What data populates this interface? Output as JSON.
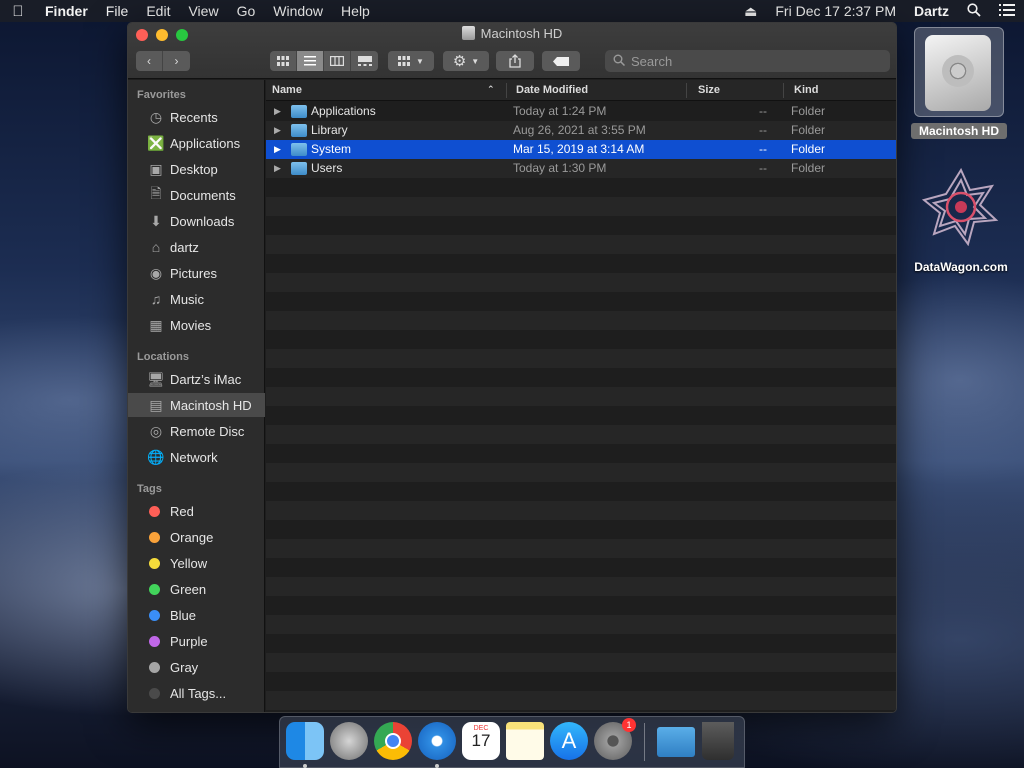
{
  "menubar": {
    "apple_icon": "apple-icon",
    "app_name": "Finder",
    "menus": [
      "File",
      "Edit",
      "View",
      "Go",
      "Window",
      "Help"
    ],
    "datetime": "Fri Dec 17  2:37 PM",
    "user": "Dartz"
  },
  "window": {
    "title": "Macintosh HD",
    "search_placeholder": "Search"
  },
  "sidebar": {
    "favorites_heading": "Favorites",
    "favorites": [
      {
        "label": "Recents",
        "icon": "clock-icon"
      },
      {
        "label": "Applications",
        "icon": "applications-icon"
      },
      {
        "label": "Desktop",
        "icon": "desktop-icon"
      },
      {
        "label": "Documents",
        "icon": "documents-icon"
      },
      {
        "label": "Downloads",
        "icon": "downloads-icon"
      },
      {
        "label": "dartz",
        "icon": "home-icon"
      },
      {
        "label": "Pictures",
        "icon": "camera-icon"
      },
      {
        "label": "Music",
        "icon": "music-icon"
      },
      {
        "label": "Movies",
        "icon": "film-icon"
      }
    ],
    "locations_heading": "Locations",
    "locations": [
      {
        "label": "Dartz’s iMac",
        "icon": "imac-icon"
      },
      {
        "label": "Macintosh HD",
        "icon": "hard-drive-icon",
        "selected": true
      },
      {
        "label": "Remote Disc",
        "icon": "disc-icon"
      },
      {
        "label": "Network",
        "icon": "network-icon"
      }
    ],
    "tags_heading": "Tags",
    "tags": [
      {
        "label": "Red",
        "color": "#fe5f57"
      },
      {
        "label": "Orange",
        "color": "#f9a23a"
      },
      {
        "label": "Yellow",
        "color": "#f5dc3b"
      },
      {
        "label": "Green",
        "color": "#42d45b"
      },
      {
        "label": "Blue",
        "color": "#3a8ef6"
      },
      {
        "label": "Purple",
        "color": "#c067e8"
      },
      {
        "label": "Gray",
        "color": "#a5a5a5"
      },
      {
        "label": "All Tags...",
        "color": "#4a4a4a"
      }
    ]
  },
  "list": {
    "columns": {
      "name": "Name",
      "date": "Date Modified",
      "size": "Size",
      "kind": "Kind"
    },
    "rows": [
      {
        "name": "Applications",
        "date": "Today at 1:24 PM",
        "size": "--",
        "kind": "Folder"
      },
      {
        "name": "Library",
        "date": "Aug 26, 2021 at 3:55 PM",
        "size": "--",
        "kind": "Folder"
      },
      {
        "name": "System",
        "date": "Mar 15, 2019 at 3:14 AM",
        "size": "--",
        "kind": "Folder",
        "selected": true
      },
      {
        "name": "Users",
        "date": "Today at 1:30 PM",
        "size": "--",
        "kind": "Folder"
      }
    ]
  },
  "desktop": {
    "drive_label": "Macintosh HD",
    "shortcut_label": "DataWagon.com"
  },
  "dock": {
    "apps": [
      "finder-icon",
      "launchpad-icon",
      "chrome-icon",
      "safari-icon",
      "calendar-icon",
      "notes-icon",
      "app-store-icon",
      "system-preferences-icon",
      "downloads-folder-icon",
      "trash-icon"
    ],
    "calendar_month": "DEC",
    "calendar_day": "17",
    "prefs_badge": "1"
  }
}
